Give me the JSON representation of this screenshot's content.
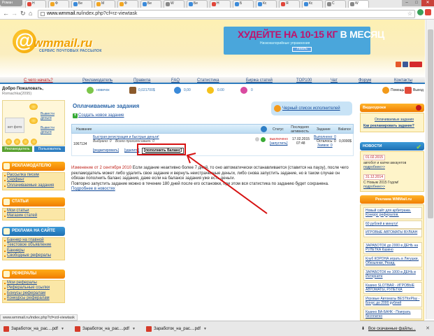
{
  "browser": {
    "profile": "Роман",
    "tabs": [
      "Н",
      "Ф",
      "Бе",
      "М",
      "Ф",
      "Бе",
      "W",
      "Бе",
      "Н",
      "Б",
      "Кс",
      "Я",
      "Кс",
      "С",
      "W"
    ],
    "active_tab_label": "W",
    "url_host": "www.wmmail.ru",
    "url_path": "/index.php?cf=rz-viewtask",
    "status_url": "www.wmmail.ru/index.php?cf=zd-viewtask",
    "downloads": [
      "Заработок_на_рас....pdf",
      "Заработок_на_рас....pdf",
      "Заработок_на_рас....pdf"
    ],
    "all_downloads": "Все скачанные файлы..."
  },
  "site": {
    "logo_text": "wmmail.ru",
    "logo_sub": "СЕРВИС ПОЧТОВЫХ РАССЫЛОК",
    "banner_title": "ХУДЕЙТЕ НА 10-15 КГ",
    "banner_title_suffix": "В МЕСЯЦ",
    "banner_sub": "Низкокалорийные упражнения",
    "banner_btn": "Узнать",
    "menu": [
      "С чего начать?",
      "Рекламодатель",
      "Правила",
      "FAQ",
      "Статистика",
      "Биржа статей",
      "TOP100",
      "Чат",
      "Форум",
      "Контакты"
    ],
    "welcome": "Добро Пожаловать,",
    "username": "Romachka(2095)",
    "stats": [
      {
        "label": "новичок"
      },
      {
        "label": "0,021700$"
      },
      {
        "label": "0,00"
      },
      {
        "label": "0.00"
      },
      {
        "label": "0"
      }
    ],
    "help": "Помощь",
    "logout": "Выход"
  },
  "left": {
    "nophoto": "нет фото",
    "withdraw": "Вывести деньги",
    "advertiser_btn": "Рекламодатель",
    "user_btn": "Пользователь",
    "sections": [
      {
        "title": "РЕКЛАМОДАТЕЛЮ",
        "items": [
          "Рассылка писем",
          "Серфинг",
          "Оплачиваемые задания"
        ]
      },
      {
        "title": "СТАТЬИ",
        "items": [
          "Мои статьи",
          "Магазин статей"
        ]
      },
      {
        "title": "РЕКЛАМА НА САЙТЕ",
        "items": [
          "Баннер на главной",
          "Текстовое объявление",
          "Баннеры",
          "Свободные рефералы"
        ]
      },
      {
        "title": "РЕФЕРАЛЫ",
        "items": [
          "Мои рефералы",
          "Реферальные ссылки",
          "Бонусы рефералам",
          "Конкурсы рефералам"
        ]
      }
    ]
  },
  "main": {
    "title": "Оплачиваемые задания",
    "add_new": "Создать новое задание",
    "blacklist": "Черный список исполнителей",
    "columns": {
      "name": "Название",
      "status": "Статус",
      "last": "Последняя активность",
      "task": "Задание",
      "balance": "Balance"
    },
    "row": {
      "id": "1067134",
      "title": "Быстрая регистрация и быстрые деньги!",
      "sub1": "Выбрано: 0",
      "sub2": "Всего проголосовало: 0",
      "edit": "[редактировать]",
      "delete": "[удалить]",
      "refill": "пополнить баланс",
      "status": "выключено",
      "start": "[запустить]",
      "date": "17.02.2015",
      "time": "07:48",
      "done": "Выполнено: 0",
      "left": "Осталось: 0",
      "orders": "Заявок: 0",
      "balance": "0,0000$"
    },
    "notice_date": "Изменение от 2 сентября 2010",
    "notice_body": "Если задание неактивно более 7 дней, то оно автоматически останавливается (ставится на паузу), после чего рекламодатель может либо удалить свое задание и вернуть неистраченные деньги, либо снова запустить задание, но в таком случае он обязан пополнить баланс задания, даже если на балансе задания уже есть деньги.",
    "notice_body2": "Повторно запустить задание можно в течение 180 дней после его остановки, при этом вся статистика по заданию будет сохранена.",
    "notice_more": "Подробнее в новостях"
  },
  "right": {
    "video_title": "Видеоуроки",
    "video_links": [
      "Оплачиваемые задания",
      "Как рекламировать задание?"
    ],
    "news_title": "НОВОСТИ",
    "news": [
      {
        "date": "01.02.2015",
        "text": "автобот и капчи аккаунтов",
        "more": "подробнее>>"
      },
      {
        "date": "31.12.2014",
        "text": "С Новым 2015 Годом!",
        "more": "подробнее>>"
      }
    ],
    "ads_title": "Реклама WMMail.ru",
    "ads": [
      "Новый сайт для арбитража. Конкурс рефералов.",
      "60 рублей в минуту!",
      "ИГРОВЫЕ АВТОМАТЫ ВУЛКАН",
      "ЗАРАБОТОК до 2000 в ДЕНЬ на РУЛЕТКА Казино",
      "Клуб КОРОНА играть в Лягушки, Обезьянки, Резид.",
      "ЗАРАБОТОК по 1000 в ДЕНЬ в Интернете",
      "Казино SLOTBAR - ИГРОВЫЕ АВТОМАТЫ, РУЛЕТКА",
      "Игровые Автоматы BESTforPlay - Бонус до 2000 рублей",
      "Казино ВА-БАНК - Поиграть бесплатно"
    ]
  }
}
